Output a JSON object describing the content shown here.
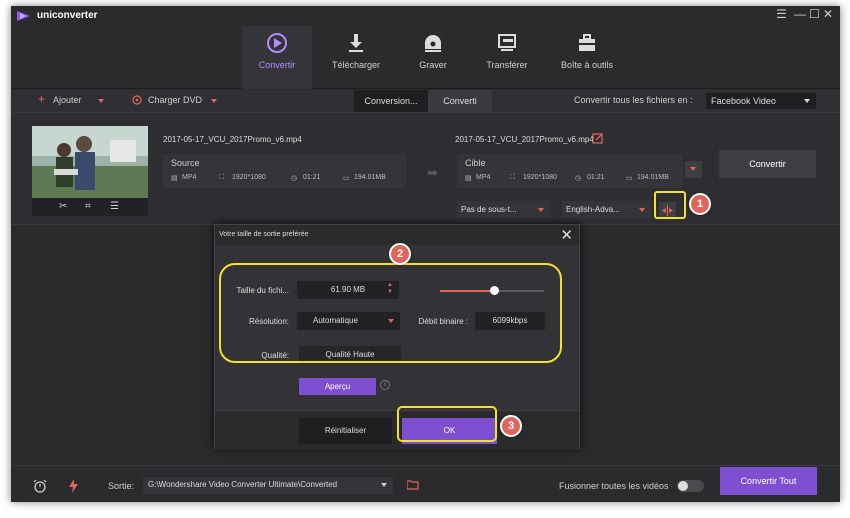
{
  "app": {
    "name": "uniconverter"
  },
  "window": {
    "menu_icon": "hamburger-icon",
    "minimize": "—",
    "maximize": "☐",
    "close": "✕"
  },
  "nav": {
    "tabs": [
      {
        "label": "Convertir",
        "icon": "convert-icon",
        "active": true
      },
      {
        "label": "Télécharger",
        "icon": "download-icon",
        "active": false
      },
      {
        "label": "Graver",
        "icon": "burn-disc-icon",
        "active": false
      },
      {
        "label": "Transférer",
        "icon": "transfer-icon",
        "active": false
      },
      {
        "label": "Boîte à outils",
        "icon": "toolbox-icon",
        "active": false
      }
    ]
  },
  "toolbar": {
    "add_label": "Ajouter",
    "dvd_label": "Charger DVD",
    "tab_converting": "Conversion...",
    "tab_converted": "Converti",
    "convert_all_label": "Convertir tous les fichiers en :",
    "convert_all_value": "Facebook Video"
  },
  "file": {
    "source_name": "2017-05-17_VCU_2017Promo_v6.mp4",
    "target_name": "2017-05-17_VCU_2017Promo_v6.mp4",
    "source": {
      "title": "Source",
      "format": "MP4",
      "resolution": "1920*1080",
      "duration": "01:21",
      "size": "194.01MB"
    },
    "target": {
      "title": "Cible",
      "format": "MP4",
      "resolution": "1920*1080",
      "duration": "01:21",
      "size": "194.01MB"
    },
    "convert_button": "Convertir",
    "subtitle_value": "Pas de sous-t...",
    "audio_value": "English-Adva..."
  },
  "dialog": {
    "title": "Votre taille de sortie préférée",
    "size_label": "Taille du fichi...",
    "size_value": "61.90  MB",
    "size_slider_fraction": 0.52,
    "resolution_label": "Résolution:",
    "resolution_value": "Automatique",
    "bitrate_label": "Débit binaire :",
    "bitrate_value": "6099kbps",
    "quality_label": "Qualité:",
    "quality_value": "Qualité Haute",
    "preview_button": "Aperçu",
    "reset_button": "Réinitialiser",
    "ok_button": "OK"
  },
  "callouts": [
    "1",
    "2",
    "3"
  ],
  "footer": {
    "output_label": "Sortie:",
    "output_path": "G:\\Wondershare Video Converter Ultimate\\Converted",
    "merge_label": "Fusionner toutes les vidéos",
    "merge_on": false,
    "convert_all_button": "Convertir Tout"
  },
  "colors": {
    "accent": "#7e4fd1",
    "active_tab": "#b38cff",
    "callout": "#e0655a",
    "highlight": "#f1e32a"
  }
}
